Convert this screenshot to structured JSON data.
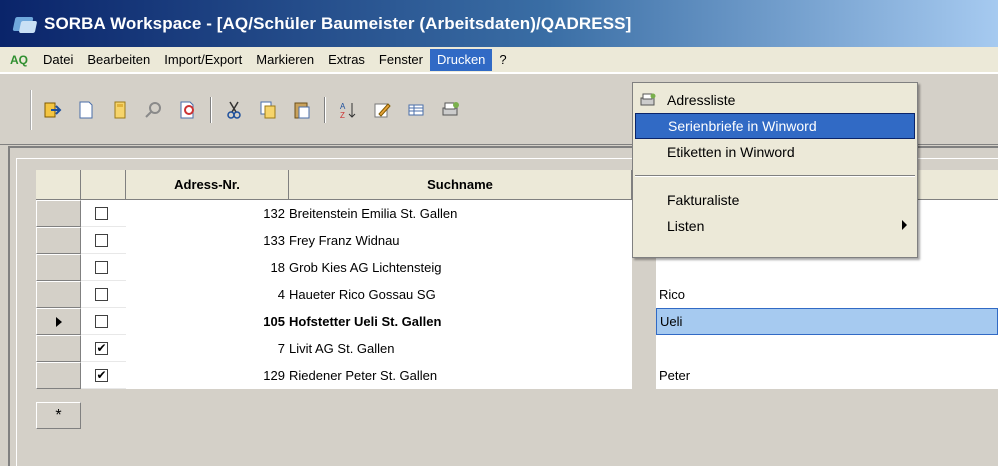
{
  "window": {
    "title": "SORBA Workspace - [AQ/Schüler Baumeister (Arbeitsdaten)/QADRESS]",
    "icon": "sorba-app-icon"
  },
  "menubar": {
    "logo": "AQ",
    "items": [
      "Datei",
      "Bearbeiten",
      "Import/Export",
      "Markieren",
      "Extras",
      "Fenster",
      "Drucken",
      "?"
    ],
    "active": "Drucken"
  },
  "toolbar": {
    "buttons": [
      "exit-icon",
      "new-icon",
      "open-icon",
      "search-icon",
      "find-icon",
      "cut-icon",
      "copy-icon",
      "paste-icon",
      "sort-icon",
      "edit-icon",
      "table-icon",
      "print-icon"
    ]
  },
  "grid": {
    "headers": {
      "nr": "Adress-Nr.",
      "name": "Suchname"
    },
    "rows": [
      {
        "checked": false,
        "nr": "132",
        "name": "Breitenstein Emilia St. Gallen",
        "extra": "",
        "current": false
      },
      {
        "checked": false,
        "nr": "133",
        "name": "Frey Franz Widnau",
        "extra": "",
        "current": false
      },
      {
        "checked": false,
        "nr": "18",
        "name": "Grob Kies AG Lichtensteig",
        "extra": "",
        "current": false
      },
      {
        "checked": false,
        "nr": "4",
        "name": "Haueter Rico Gossau SG",
        "extra": "Rico",
        "current": false
      },
      {
        "checked": false,
        "nr": "105",
        "name": "Hofstetter Ueli St. Gallen",
        "extra": "Ueli",
        "current": true
      },
      {
        "checked": true,
        "nr": "7",
        "name": "Livit AG St. Gallen",
        "extra": "",
        "current": false
      },
      {
        "checked": true,
        "nr": "129",
        "name": "Riedener Peter St. Gallen",
        "extra": "Peter",
        "current": false
      }
    ],
    "new_row_marker": "*"
  },
  "drucken_menu": {
    "items": [
      {
        "label": "Adressliste",
        "icon": "printer-icon"
      },
      {
        "label": "Serienbriefe in Winword",
        "highlighted": true
      },
      {
        "label": "Etiketten in Winword"
      },
      {
        "label": "Fakturaliste"
      },
      {
        "label": "Listen",
        "submenu": true
      }
    ]
  },
  "colors": {
    "title_start": "#0a246a",
    "title_end": "#a6caf0",
    "menu_highlight": "#316ac5",
    "window_bg": "#d4d0c8"
  }
}
